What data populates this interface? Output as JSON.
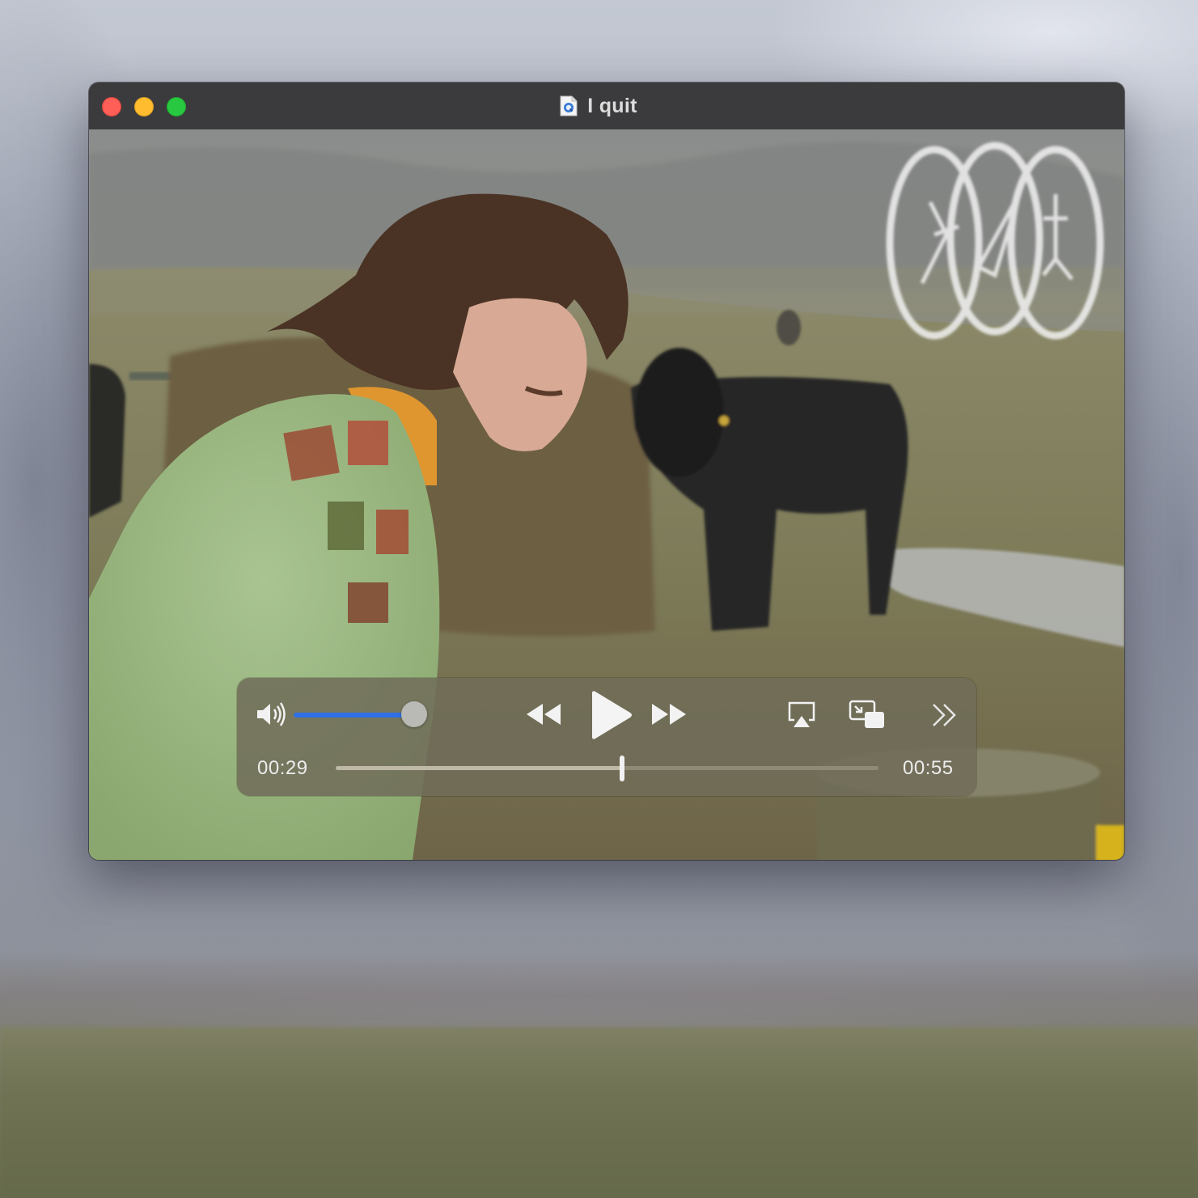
{
  "window": {
    "title": "I quit",
    "buttons": [
      "close",
      "minimize",
      "maximize"
    ],
    "document_icon": "quicktime-document-icon"
  },
  "player": {
    "current_time": "00:29",
    "duration": "00:55",
    "progress_fraction": 0.527,
    "volume_fraction": 0.92,
    "controls": {
      "volume_icon": "speaker-volume-icon",
      "rewind_icon": "rewind-icon",
      "play_icon": "play-icon",
      "fast_forward_icon": "fast-forward-icon",
      "airplay_icon": "airplay-icon",
      "picture_in_picture_icon": "picture-in-picture-icon",
      "more_icon": "chevrons-right-icon"
    },
    "colors": {
      "volume_fill": "#2f6fe8",
      "scrub_fill": "#bdb9a6"
    }
  },
  "video_frame": {
    "watermark_icon": "three-figure-oval-logo"
  }
}
